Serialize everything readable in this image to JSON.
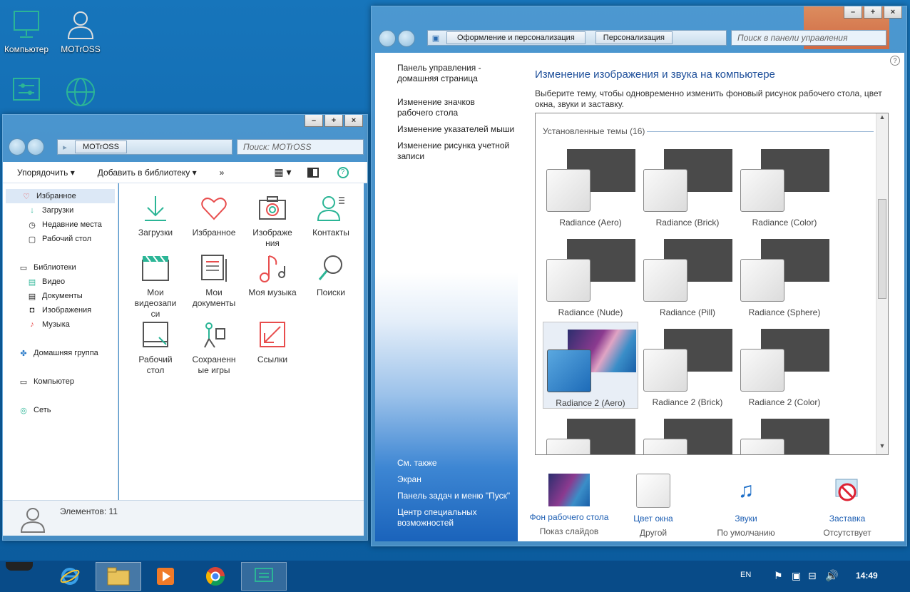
{
  "desktop": {
    "icons": [
      {
        "label": "Компьютер",
        "icon": "monitor-icon"
      },
      {
        "label": "MOTrOSS",
        "icon": "user-icon"
      },
      {
        "label": "",
        "icon": "control-panel-icon"
      },
      {
        "label": "",
        "icon": "globe-icon"
      }
    ]
  },
  "explorer": {
    "caption": {
      "minimize": "–",
      "maximize": "+",
      "close": "×"
    },
    "address": {
      "crumb": "MOTrOSS"
    },
    "search_placeholder": "Поиск: MOTrOSS",
    "toolbar": {
      "organize": "Упорядочить",
      "add_library": "Добавить в библиотеку",
      "more": "»"
    },
    "nav": {
      "favorites": "Избранное",
      "downloads": "Загрузки",
      "recent": "Недавние места",
      "desktop": "Рабочий стол",
      "libraries": "Библиотеки",
      "video": "Видео",
      "documents": "Документы",
      "images": "Изображения",
      "music": "Музыка",
      "homegroup": "Домашняя группа",
      "computer": "Компьютер",
      "network": "Сеть"
    },
    "items": {
      "downloads": "Загрузки",
      "favorites": "Избранное",
      "images": "Изображе ния",
      "contacts": "Контакты",
      "videos": "Мои видеозапи си",
      "documents": "Мои документы",
      "music": "Моя музыка",
      "searches": "Поиски",
      "desktop": "Рабочий стол",
      "games": "Сохраненн ые игры",
      "links": "Ссылки"
    },
    "status": "Элементов: 11"
  },
  "control_panel": {
    "caption": {
      "minimize": "–",
      "maximize": "+",
      "close": "×"
    },
    "address": {
      "crumb1": "Оформление и персонализация",
      "crumb2": "Персонализация"
    },
    "search_placeholder": "Поиск в панели управления",
    "left": {
      "home": "Панель управления - домашняя страница",
      "icons": "Изменение значков рабочего стола",
      "pointers": "Изменение указателей мыши",
      "account_pic": "Изменение рисунка учетной записи",
      "see_also": "См. также",
      "screen": "Экран",
      "taskbar": "Панель задач и меню \"Пуск\"",
      "access": "Центр специальных возможностей"
    },
    "title": "Изменение изображения и звука на компьютере",
    "description": "Выберите тему, чтобы одновременно изменить фоновый рисунок рабочего стола, цвет окна, звуки и заставку.",
    "installed": "Установленные темы (16)",
    "themes": [
      "Radiance (Aero)",
      "Radiance (Brick)",
      "Radiance (Color)",
      "Radiance (Nude)",
      "Radiance (Pill)",
      "Radiance (Sphere)",
      "Radiance 2 (Aero)",
      "Radiance 2 (Brick)",
      "Radiance 2 (Color)"
    ],
    "bottom": {
      "wallpaper": {
        "title": "Фон рабочего стола",
        "value": "Показ слайдов"
      },
      "color": {
        "title": "Цвет окна",
        "value": "Другой"
      },
      "sounds": {
        "title": "Звуки",
        "value": "По умолчанию"
      },
      "screensaver": {
        "title": "Заставка",
        "value": "Отсутствует"
      }
    }
  },
  "taskbar": {
    "lang": "EN",
    "time": "14:49"
  },
  "colors": {
    "accent": "#1e5fb3",
    "teal": "#2bb596",
    "red": "#e84d4d"
  }
}
